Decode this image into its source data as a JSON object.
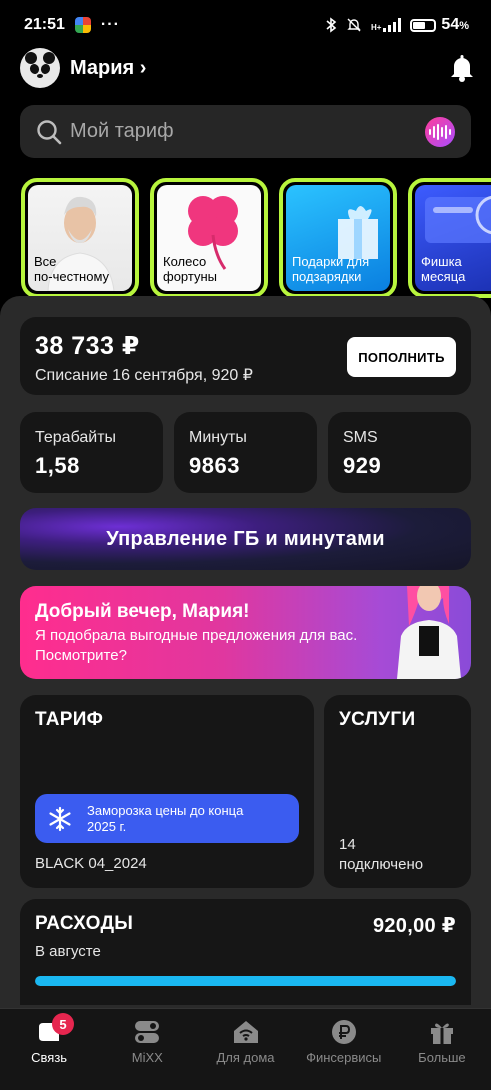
{
  "status_bar": {
    "time": "21:51",
    "battery": "54",
    "battery_unit": "%",
    "network": "H+",
    "battery_level": 0.54
  },
  "header": {
    "user_name": "Мария",
    "chevron": "›"
  },
  "search": {
    "placeholder": "Мой тариф"
  },
  "stories": [
    {
      "label": "Все\nпо-честному"
    },
    {
      "label": "Колесо\nфортуны"
    },
    {
      "label": "Подарки для\nподзарядки"
    },
    {
      "label": "Фишка\nмесяца"
    }
  ],
  "balance": {
    "amount": "38 733 ₽",
    "note": "Списание 16 сентября, 920 ₽",
    "topup_label": "ПОПОЛНИТЬ"
  },
  "stats": [
    {
      "label": "Терабайты",
      "value": "1,58"
    },
    {
      "label": "Минуты",
      "value": "9863"
    },
    {
      "label": "SMS",
      "value": "929"
    }
  ],
  "manage": {
    "label": "Управление ГБ и минутами"
  },
  "promo": {
    "title": "Добрый вечер, Мария!",
    "text": "Я подобрала выгодные предложения для вас. Посмотрите?"
  },
  "tariff": {
    "title": "ТАРИФ",
    "freeze_text": "Заморозка цены до конца 2025 г.",
    "name": "BLACK 04_2024"
  },
  "services": {
    "title": "УСЛУГИ",
    "count": "14",
    "count_label": "подключено"
  },
  "expenses": {
    "title": "РАСХОДЫ",
    "amount": "920,00 ₽",
    "period": "В августе",
    "progress": 1.0
  },
  "tabbar": {
    "badge": "5",
    "items": [
      {
        "label": "Связь",
        "icon": "chat-icon"
      },
      {
        "label": "MiXX",
        "icon": "mixx-icon"
      },
      {
        "label": "Для дома",
        "icon": "home-wifi-icon"
      },
      {
        "label": "Финсервисы",
        "icon": "ruble-icon"
      },
      {
        "label": "Больше",
        "icon": "gift-icon"
      }
    ]
  }
}
